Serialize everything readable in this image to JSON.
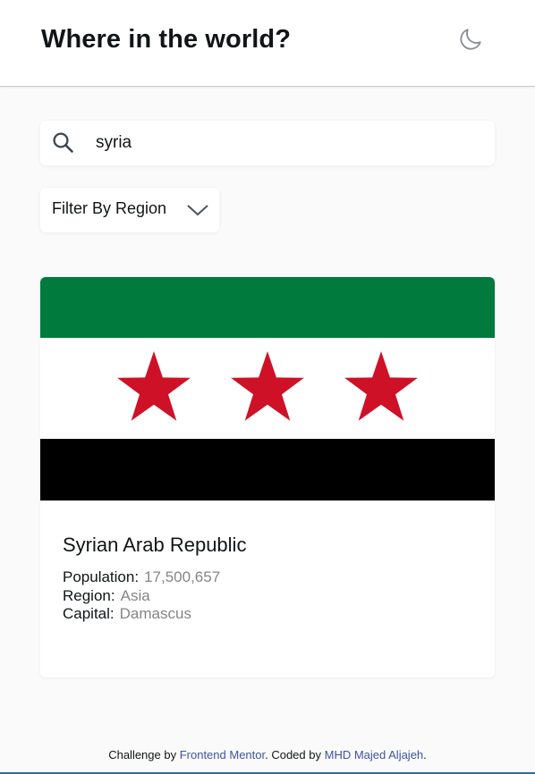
{
  "header": {
    "title": "Where in the world?",
    "theme_toggle_icon": "moon-icon"
  },
  "search": {
    "icon": "search-icon",
    "value": "syria",
    "placeholder": ""
  },
  "filter": {
    "label": "Filter By Region",
    "icon": "chevron-down-icon"
  },
  "country_card": {
    "flag_colors": {
      "top": "#007a3d",
      "middle": "#ffffff",
      "bottom": "#000000",
      "stars": "#ce1126"
    },
    "name": "Syrian Arab Republic",
    "population_label": "Population:",
    "population": "17,500,657",
    "region_label": "Region:",
    "region": "Asia",
    "capital_label": "Capital:",
    "capital": "Damascus"
  },
  "footer": {
    "prefix": "Challenge by",
    "mentor_link": "Frontend Mentor",
    "middle": ". Coded by",
    "author_link": "MHD Majed Aljajeh",
    "suffix": "."
  },
  "colors": {
    "background": "#fafafa",
    "surface": "#ffffff",
    "text": "#111517",
    "muted_text": "#858585",
    "link": "#3e54a3"
  }
}
